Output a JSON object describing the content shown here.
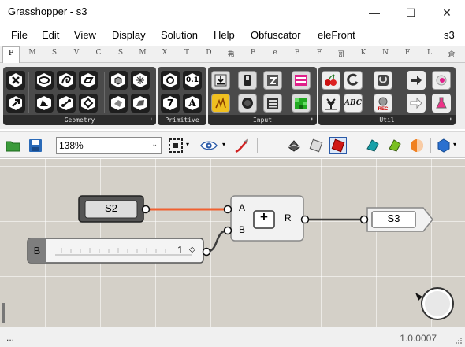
{
  "window": {
    "title": "Grasshopper - s3",
    "minimize": "—",
    "maximize": "☐",
    "close": "✕"
  },
  "menu": {
    "items": [
      "File",
      "Edit",
      "View",
      "Display",
      "Solution",
      "Help",
      "Obfuscator",
      "eleFront"
    ],
    "right_label": "s3"
  },
  "tabs": [
    "P",
    "M",
    "S",
    "V",
    "C",
    "S",
    "M",
    "X",
    "T",
    "D",
    "弗",
    "F",
    "e",
    "F",
    "F",
    "哥",
    "K",
    "N",
    "F",
    "L",
    "倉"
  ],
  "ribbon": {
    "groups": [
      {
        "caption": "Geometry",
        "icons": [
          "hexagon-point-icon",
          "circle-icon",
          "curve-icon",
          "surface-icon",
          "box-icon",
          "mesh-icon",
          "vector-icon",
          "brep-icon",
          "field-icon",
          "plane-icon",
          "geometry-icon",
          "group-icon"
        ]
      },
      {
        "caption": "Primitive",
        "icons": [
          "boolean-icon",
          "number-icon",
          "integer-icon",
          "text-icon"
        ]
      },
      {
        "caption": "Input",
        "icons": [
          "pull-down-icon",
          "toggle-icon",
          "slider-icon",
          "gradient-icon",
          "heat-icon",
          "button-icon",
          "list-icon",
          "panel-icon"
        ]
      },
      {
        "caption": "Util",
        "icons": [
          "cherry-icon",
          "ring-icon",
          "data-recorder-icon",
          "relay-icon",
          "param-icon",
          "tree-icon",
          "text-tag-icon",
          "rec-icon",
          "arrow-icon",
          "potion-icon"
        ]
      }
    ],
    "rec_label": "REC",
    "abc_label": "ABC",
    "primitive_zero_label": "0.1",
    "primitive_seven_label": "7",
    "primitive_text_label": "A",
    "expand_arrow": "⬇"
  },
  "toolbar": {
    "zoom_value": "138%",
    "zoom_dropdown": "⌄"
  },
  "canvas": {
    "nodes": {
      "s2": {
        "label": "S2"
      },
      "slider": {
        "label": "B",
        "value": "1",
        "marker": "◇"
      },
      "addition": {
        "input_a": "A",
        "input_b": "B",
        "output": "R",
        "operator": "+"
      },
      "s3": {
        "label": "S3"
      }
    },
    "wires": {
      "s2_to_a": {
        "color": "#f06030"
      },
      "slider_to_b": {
        "color": "#3c3c3c"
      },
      "r_to_s3": {
        "color": "#3c3c3c"
      }
    }
  },
  "status": {
    "dots": "...",
    "version": "1.0.0007"
  },
  "colors": {
    "accent": "#f06030",
    "canvas_bg": "#d4d0c8",
    "ribbon_dark": "#4a4a4a"
  }
}
